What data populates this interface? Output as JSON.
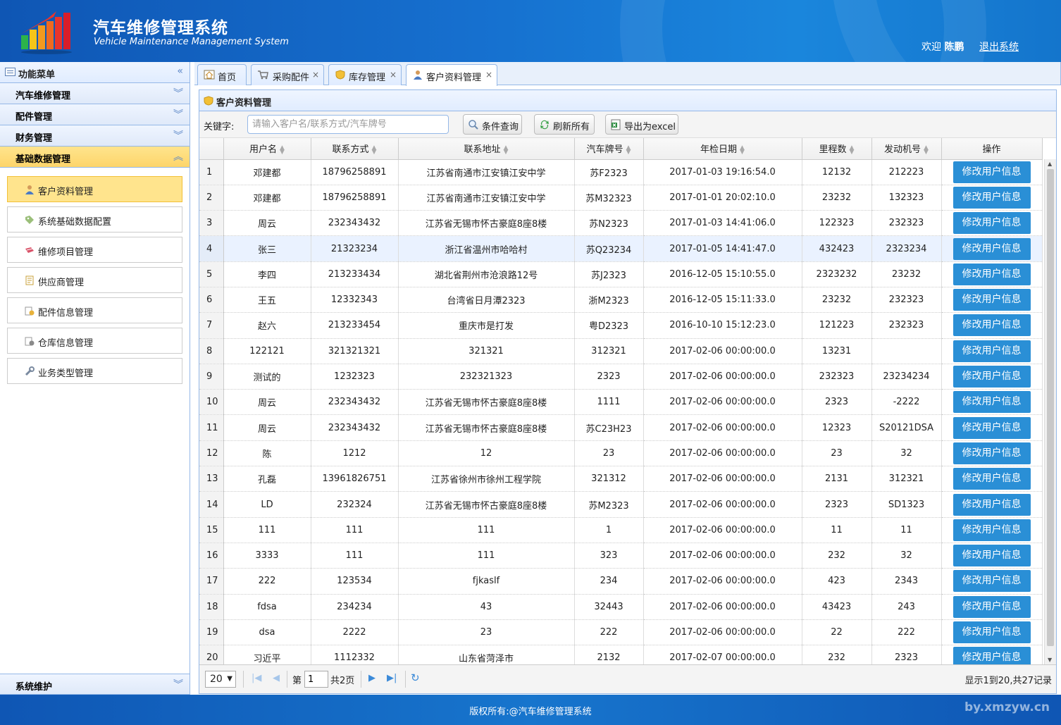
{
  "header": {
    "title": "汽车维修管理系统",
    "subtitle": "Vehicle Maintenance Management System",
    "welcome_prefix": "欢迎",
    "user_name": "陈鹏",
    "logout_label": "退出系统"
  },
  "sidebar": {
    "title": "功能菜单",
    "sections": [
      {
        "label": "汽车维修管理"
      },
      {
        "label": "配件管理"
      },
      {
        "label": "财务管理"
      },
      {
        "label": "基础数据管理"
      }
    ],
    "items": [
      {
        "label": "客户资料管理",
        "icon": "user-icon"
      },
      {
        "label": "系统基础数据配置",
        "icon": "tag-icon"
      },
      {
        "label": "维修项目管理",
        "icon": "tools-icon"
      },
      {
        "label": "供应商管理",
        "icon": "document-icon"
      },
      {
        "label": "配件信息管理",
        "icon": "parts-icon"
      },
      {
        "label": "仓库信息管理",
        "icon": "warehouse-icon"
      },
      {
        "label": "业务类型管理",
        "icon": "wrench-icon"
      }
    ],
    "bottom_section": "系统维护"
  },
  "tabs": [
    {
      "label": "首页",
      "icon": "home-icon"
    },
    {
      "label": "采购配件",
      "icon": "cart-icon"
    },
    {
      "label": "库存管理",
      "icon": "shield-icon"
    },
    {
      "label": "客户资料管理",
      "icon": "user-icon"
    }
  ],
  "panel": {
    "title": "客户资料管理",
    "keyword_label": "关键字:",
    "search_placeholder": "请输入客户名/联系方式/汽车牌号",
    "query_label": "条件查询",
    "refresh_label": "刷新所有",
    "export_label": "导出为excel"
  },
  "table": {
    "columns": [
      "用户名",
      "联系方式",
      "联系地址",
      "汽车牌号",
      "年检日期",
      "里程数",
      "发动机号",
      "操作"
    ],
    "action_label": "修改用户信息",
    "rows": [
      {
        "n": "1",
        "name": "邓建都",
        "phone": "18796258891",
        "addr": "江苏省南通市江安镇江安中学",
        "plate": "苏F2323",
        "date": "2017-01-03 19:16:54.0",
        "km": "12132",
        "engine": "212223"
      },
      {
        "n": "2",
        "name": "邓建都",
        "phone": "18796258891",
        "addr": "江苏省南通市江安镇江安中学",
        "plate": "苏M32323",
        "date": "2017-01-01 20:02:10.0",
        "km": "23232",
        "engine": "132323"
      },
      {
        "n": "3",
        "name": "周云",
        "phone": "232343432",
        "addr": "江苏省无锡市怀古豪庭8座8楼",
        "plate": "苏N2323",
        "date": "2017-01-03 14:41:06.0",
        "km": "122323",
        "engine": "232323"
      },
      {
        "n": "4",
        "name": "张三",
        "phone": "21323234",
        "addr": "浙江省温州市哈哈村",
        "plate": "苏Q23234",
        "date": "2017-01-05 14:41:47.0",
        "km": "432423",
        "engine": "2323234"
      },
      {
        "n": "5",
        "name": "李四",
        "phone": "213233434",
        "addr": "湖北省荆州市沧浪路12号",
        "plate": "苏J2323",
        "date": "2016-12-05 15:10:55.0",
        "km": "2323232",
        "engine": "23232"
      },
      {
        "n": "6",
        "name": "王五",
        "phone": "12332343",
        "addr": "台湾省日月潭2323",
        "plate": "浙M2323",
        "date": "2016-12-05 15:11:33.0",
        "km": "23232",
        "engine": "232323"
      },
      {
        "n": "7",
        "name": "赵六",
        "phone": "213233454",
        "addr": "重庆市是打发",
        "plate": "粤D2323",
        "date": "2016-10-10 15:12:23.0",
        "km": "121223",
        "engine": "232323"
      },
      {
        "n": "8",
        "name": "122121",
        "phone": "321321321",
        "addr": "321321",
        "plate": "312321",
        "date": "2017-02-06 00:00:00.0",
        "km": "13231",
        "engine": ""
      },
      {
        "n": "9",
        "name": "测试的",
        "phone": "1232323",
        "addr": "232321323",
        "plate": "2323",
        "date": "2017-02-06 00:00:00.0",
        "km": "232323",
        "engine": "23234234"
      },
      {
        "n": "10",
        "name": "周云",
        "phone": "232343432",
        "addr": "江苏省无锡市怀古豪庭8座8楼",
        "plate": "1111",
        "date": "2017-02-06 00:00:00.0",
        "km": "2323",
        "engine": "-2222"
      },
      {
        "n": "11",
        "name": "周云",
        "phone": "232343432",
        "addr": "江苏省无锡市怀古豪庭8座8楼",
        "plate": "苏C23H23",
        "date": "2017-02-06 00:00:00.0",
        "km": "12323",
        "engine": "S20121DSA"
      },
      {
        "n": "12",
        "name": "陈",
        "phone": "1212",
        "addr": "12",
        "plate": "23",
        "date": "2017-02-06 00:00:00.0",
        "km": "23",
        "engine": "32"
      },
      {
        "n": "13",
        "name": "孔磊",
        "phone": "13961826751",
        "addr": "江苏省徐州市徐州工程学院",
        "plate": "321312",
        "date": "2017-02-06 00:00:00.0",
        "km": "2131",
        "engine": "312321"
      },
      {
        "n": "14",
        "name": "LD",
        "phone": "232324",
        "addr": "江苏省无锡市怀古豪庭8座8楼",
        "plate": "苏M2323",
        "date": "2017-02-06 00:00:00.0",
        "km": "2323",
        "engine": "SD1323"
      },
      {
        "n": "15",
        "name": "111",
        "phone": "111",
        "addr": "111",
        "plate": "1",
        "date": "2017-02-06 00:00:00.0",
        "km": "11",
        "engine": "11"
      },
      {
        "n": "16",
        "name": "3333",
        "phone": "111",
        "addr": "111",
        "plate": "323",
        "date": "2017-02-06 00:00:00.0",
        "km": "232",
        "engine": "32"
      },
      {
        "n": "17",
        "name": "222",
        "phone": "123534",
        "addr": "fjkaslf",
        "plate": "234",
        "date": "2017-02-06 00:00:00.0",
        "km": "423",
        "engine": "2343"
      },
      {
        "n": "18",
        "name": "fdsa",
        "phone": "234234",
        "addr": "43",
        "plate": "32443",
        "date": "2017-02-06 00:00:00.0",
        "km": "43423",
        "engine": "243"
      },
      {
        "n": "19",
        "name": "dsa",
        "phone": "2222",
        "addr": "23",
        "plate": "222",
        "date": "2017-02-06 00:00:00.0",
        "km": "22",
        "engine": "222"
      },
      {
        "n": "20",
        "name": "习近平",
        "phone": "1112332",
        "addr": "山东省菏泽市",
        "plate": "2132",
        "date": "2017-02-07 00:00:00.0",
        "km": "232",
        "engine": "2323"
      }
    ]
  },
  "pager": {
    "page_size": "20",
    "page_prefix": "第",
    "current_page": "1",
    "page_total": "共2页",
    "info": "显示1到20,共27记录"
  },
  "footer": {
    "copyright": "版权所有:@汽车维修管理系统",
    "watermark": "by.xmzyw.cn"
  },
  "colors": {
    "header_blue": "#1670cf",
    "action_button": "#2a8fd6",
    "active_yellow": "#ffe48d"
  }
}
